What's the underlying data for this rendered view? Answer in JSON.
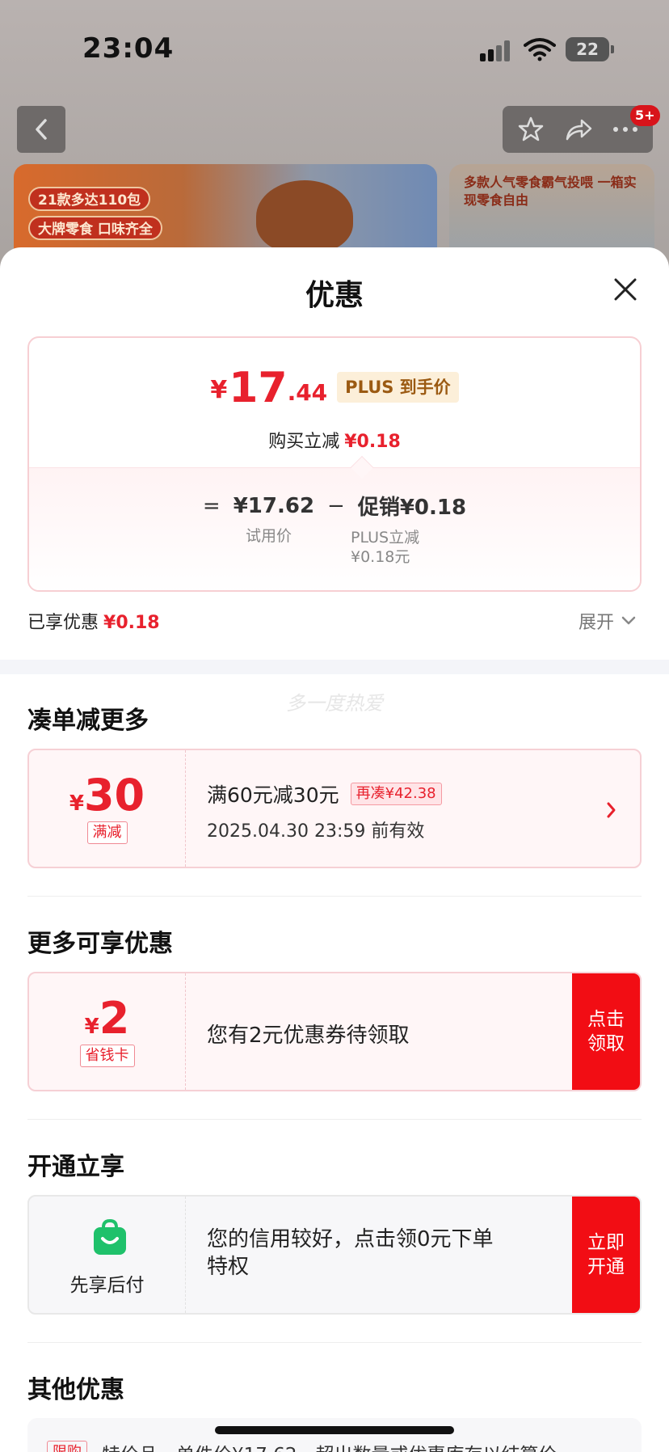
{
  "status_bar": {
    "time": "23:04",
    "battery": "22"
  },
  "nav": {
    "badge": "5+"
  },
  "banner": {
    "tag1": "21款多达110包",
    "tag2": "大牌零食 口味齐全",
    "side_title": "多款人气零食霸气投喂 一箱实现零食自由"
  },
  "sheet": {
    "title": "优惠",
    "price": {
      "currency": "¥",
      "integer": "17",
      "decimal": ".44",
      "plus_tag": "PLUS 到手价"
    },
    "reduce": {
      "label": "购买立减",
      "value": "¥0.18"
    },
    "formula": {
      "equals": "=",
      "base_price": "¥17.62",
      "minus": "−",
      "promo": "促销¥0.18",
      "base_label": "试用价",
      "promo_label_1": "PLUS立减",
      "promo_label_2": "¥0.18元"
    },
    "enjoyed": {
      "label": "已享优惠",
      "value": "¥0.18"
    },
    "expand": "展开",
    "watermark": "多一度热爱"
  },
  "sections": {
    "more_discount": {
      "title": "凑单减更多",
      "coupon": {
        "currency": "¥",
        "amount": "30",
        "tag": "满减",
        "rule": "满60元减30元",
        "pill": "再凑¥42.38",
        "expiry": "2025.04.30 23:59 前有效"
      }
    },
    "more_available": {
      "title": "更多可享优惠",
      "coupon": {
        "currency": "¥",
        "amount": "2",
        "tag": "省钱卡",
        "text": "您有2元优惠券待领取",
        "btn_line1": "点击",
        "btn_line2": "领取"
      }
    },
    "open_now": {
      "title": "开通立享",
      "card": {
        "label": "先享后付",
        "text_line1": "您的信用较好，点击领0元下单",
        "text_line2": "特权",
        "btn_line1": "立即",
        "btn_line2": "开通"
      }
    },
    "other": {
      "title": "其他优惠",
      "tag": "限购",
      "text": "特价品，单件价¥17.62，超出数量或优惠库存以结算价"
    }
  },
  "colors": {
    "accent_red": "#e8212d",
    "button_red": "#f20d14",
    "plus_gold": "#9b5a12",
    "paylater_green": "#1fc16b"
  }
}
